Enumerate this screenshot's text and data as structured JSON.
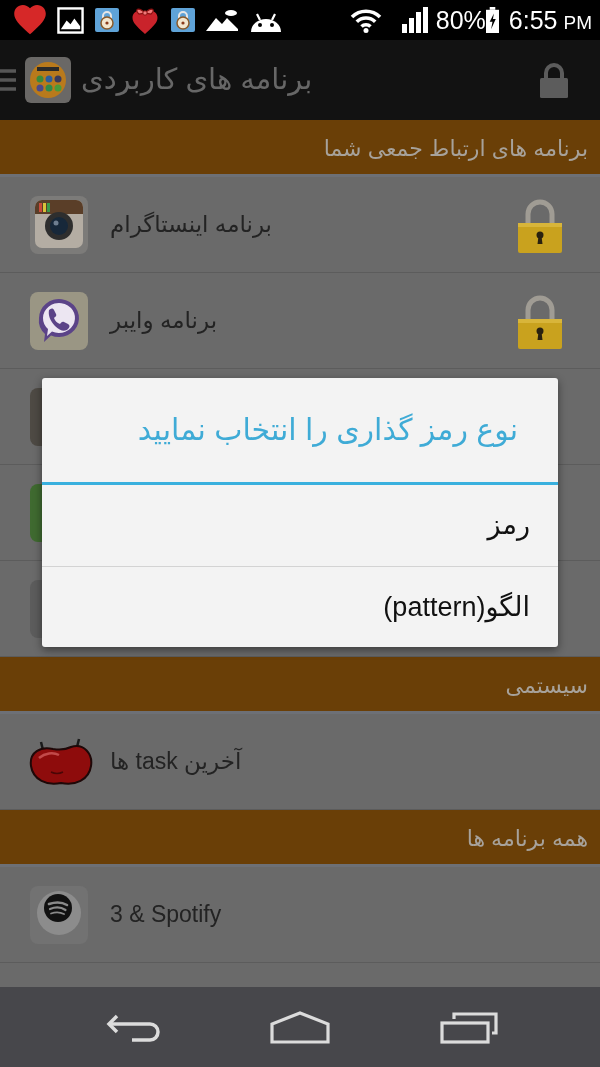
{
  "status_bar": {
    "battery_text": "80%",
    "time": "6:55",
    "meridiem": "PM"
  },
  "app_bar": {
    "title": "برنامه های کاربردی"
  },
  "sections": [
    {
      "title": "برنامه های ارتباط جمعی شما",
      "items": [
        {
          "kind": "app",
          "label": "برنامه اینستاگرام",
          "locked": true
        },
        {
          "kind": "app",
          "label": "برنامه وایبر",
          "locked": true
        },
        {
          "kind": "covered"
        },
        {
          "kind": "covered"
        },
        {
          "kind": "covered"
        }
      ]
    },
    {
      "title": "سیستمی",
      "items": [
        {
          "kind": "app",
          "label": "آخرین task ها",
          "locked": false
        }
      ]
    },
    {
      "title": "همه برنامه ها",
      "items": [
        {
          "kind": "app",
          "label": "3 & Spotify",
          "locked": false
        }
      ]
    }
  ],
  "dialog": {
    "title": "نوع رمز گذاری را انتخاب نمایید",
    "options": [
      {
        "label": "رمز"
      },
      {
        "label": "الگو(pattern)"
      }
    ]
  }
}
